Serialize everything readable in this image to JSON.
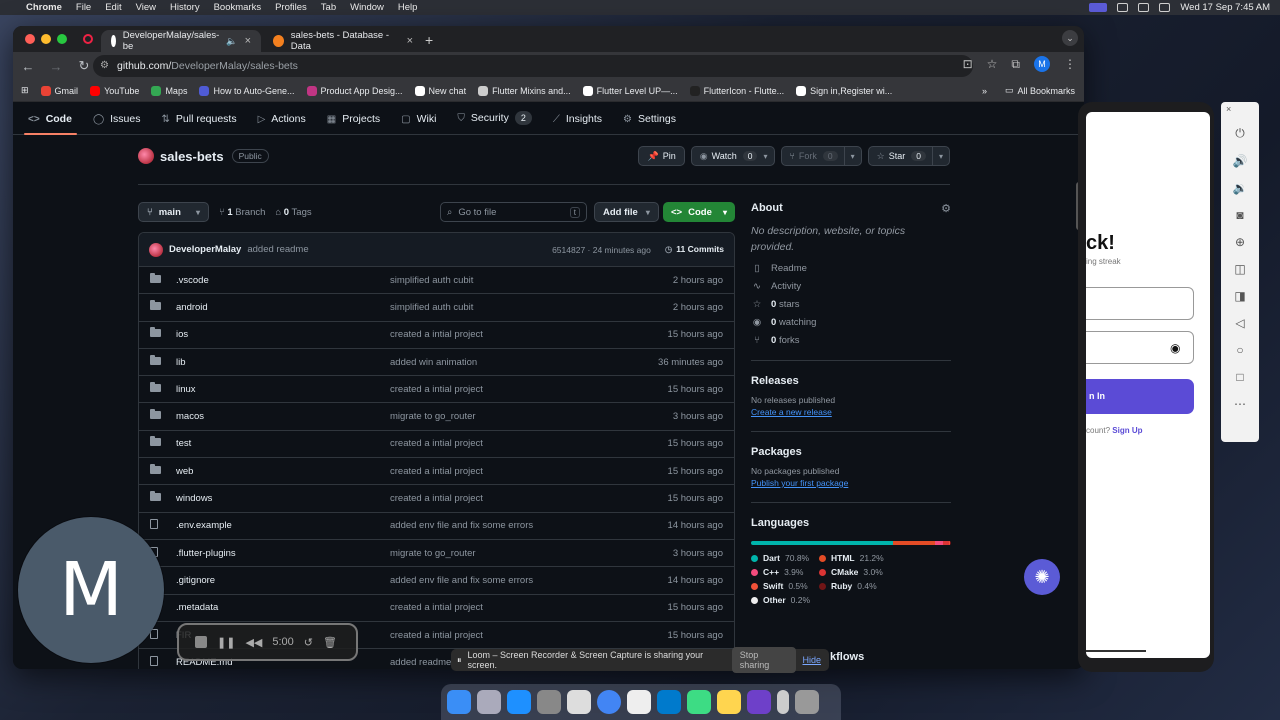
{
  "menubar": {
    "app": "Chrome",
    "items": [
      "File",
      "Edit",
      "View",
      "History",
      "Bookmarks",
      "Profiles",
      "Tab",
      "Window",
      "Help"
    ],
    "clock": "Wed 17 Sep  7:45 AM"
  },
  "browser": {
    "tabs": [
      {
        "title": "DeveloperMalay/sales-be",
        "active": true
      },
      {
        "title": "sales-bets - Database - Data",
        "active": false
      }
    ],
    "url_host": "github.com/",
    "url_path": "DeveloperMalay/sales-bets",
    "profile_initial": "M",
    "bookmarks": [
      "Gmail",
      "YouTube",
      "Maps",
      "How to Auto-Gene...",
      "Product App Desig...",
      "New chat",
      "Flutter Mixins and...",
      "Flutter Level UP—...",
      "FlutterIcon - Flutte...",
      "Sign in,Register wi..."
    ],
    "all_bookmarks": "All Bookmarks"
  },
  "repo_nav": [
    {
      "label": "Code",
      "active": true
    },
    {
      "label": "Issues"
    },
    {
      "label": "Pull requests"
    },
    {
      "label": "Actions"
    },
    {
      "label": "Projects"
    },
    {
      "label": "Wiki"
    },
    {
      "label": "Security",
      "count": "2"
    },
    {
      "label": "Insights"
    },
    {
      "label": "Settings"
    }
  ],
  "repo": {
    "name": "sales-bets",
    "visibility": "Public",
    "pin": "Pin",
    "watch": "Watch",
    "watch_count": "0",
    "fork": "Fork",
    "fork_count": "0",
    "star": "Star",
    "star_count": "0"
  },
  "controls": {
    "branch": "main",
    "branches_n": "1",
    "branches_label": "Branch",
    "tags_n": "0",
    "tags_label": "Tags",
    "goto": "Go to file",
    "goto_key": "t",
    "add_file": "Add file",
    "code": "Code"
  },
  "commit": {
    "author": "DeveloperMalay",
    "message": "added readme",
    "sha_time": "6514827 · 24 minutes ago",
    "commits": "11 Commits"
  },
  "files": [
    {
      "name": ".vscode",
      "type": "dir",
      "msg": "simplified auth cubit",
      "time": "2 hours ago"
    },
    {
      "name": "android",
      "type": "dir",
      "msg": "simplified auth cubit",
      "time": "2 hours ago"
    },
    {
      "name": "ios",
      "type": "dir",
      "msg": "created a intial project",
      "time": "15 hours ago"
    },
    {
      "name": "lib",
      "type": "dir",
      "msg": "added win animation",
      "time": "36 minutes ago"
    },
    {
      "name": "linux",
      "type": "dir",
      "msg": "created a intial project",
      "time": "15 hours ago"
    },
    {
      "name": "macos",
      "type": "dir",
      "msg": "migrate to go_router",
      "time": "3 hours ago"
    },
    {
      "name": "test",
      "type": "dir",
      "msg": "created a intial project",
      "time": "15 hours ago"
    },
    {
      "name": "web",
      "type": "dir",
      "msg": "created a intial project",
      "time": "15 hours ago"
    },
    {
      "name": "windows",
      "type": "dir",
      "msg": "created a intial project",
      "time": "15 hours ago"
    },
    {
      "name": ".env.example",
      "type": "file",
      "msg": "added env file and fix some errors",
      "time": "14 hours ago"
    },
    {
      "name": ".flutter-plugins",
      "type": "file",
      "msg": "migrate to go_router",
      "time": "3 hours ago"
    },
    {
      "name": ".gitignore",
      "type": "file",
      "msg": "added env file and fix some errors",
      "time": "14 hours ago"
    },
    {
      "name": ".metadata",
      "type": "file",
      "msg": "created a intial project",
      "time": "15 hours ago"
    },
    {
      "name": "FIR",
      "type": "file",
      "msg": "created a intial project",
      "time": "15 hours ago"
    },
    {
      "name": "README.md",
      "type": "file",
      "msg": "added readme",
      "time": ""
    }
  ],
  "about": {
    "title": "About",
    "description": "No description, website, or topics provided.",
    "readme": "Readme",
    "activity": "Activity",
    "stars_n": "0",
    "stars": "stars",
    "watching_n": "0",
    "watching": "watching",
    "forks_n": "0",
    "forks": "forks",
    "releases_title": "Releases",
    "releases_none": "No releases published",
    "releases_link": "Create a new release",
    "packages_title": "Packages",
    "packages_none": "No packages published",
    "packages_link": "Publish your first package",
    "languages_title": "Languages",
    "languages": [
      {
        "name": "Dart",
        "pct": "70.8%",
        "value": 70.8,
        "color": "#00b4ab"
      },
      {
        "name": "HTML",
        "pct": "21.2%",
        "value": 21.2,
        "color": "#e34c26"
      },
      {
        "name": "C++",
        "pct": "3.9%",
        "value": 3.9,
        "color": "#f34b7d"
      },
      {
        "name": "CMake",
        "pct": "3.0%",
        "value": 3.0,
        "color": "#da3434"
      },
      {
        "name": "Swift",
        "pct": "0.5%",
        "value": 0.5,
        "color": "#f05138"
      },
      {
        "name": "Ruby",
        "pct": "0.4%",
        "value": 0.4,
        "color": "#701516"
      },
      {
        "name": "Other",
        "pct": "0.2%",
        "value": 0.2,
        "color": "#ededed"
      }
    ],
    "workflows": "kflows"
  },
  "emulator": {
    "heading": "ck!",
    "sub": "ing streak",
    "button": "n In",
    "signup_prefix": "count?",
    "signup": "Sign Up"
  },
  "loom": {
    "avatar": "M",
    "timer": "5:00",
    "banner": "Loom – Screen Recorder & Screen Capture is sharing your screen.",
    "stop": "Stop sharing",
    "hide": "Hide"
  }
}
